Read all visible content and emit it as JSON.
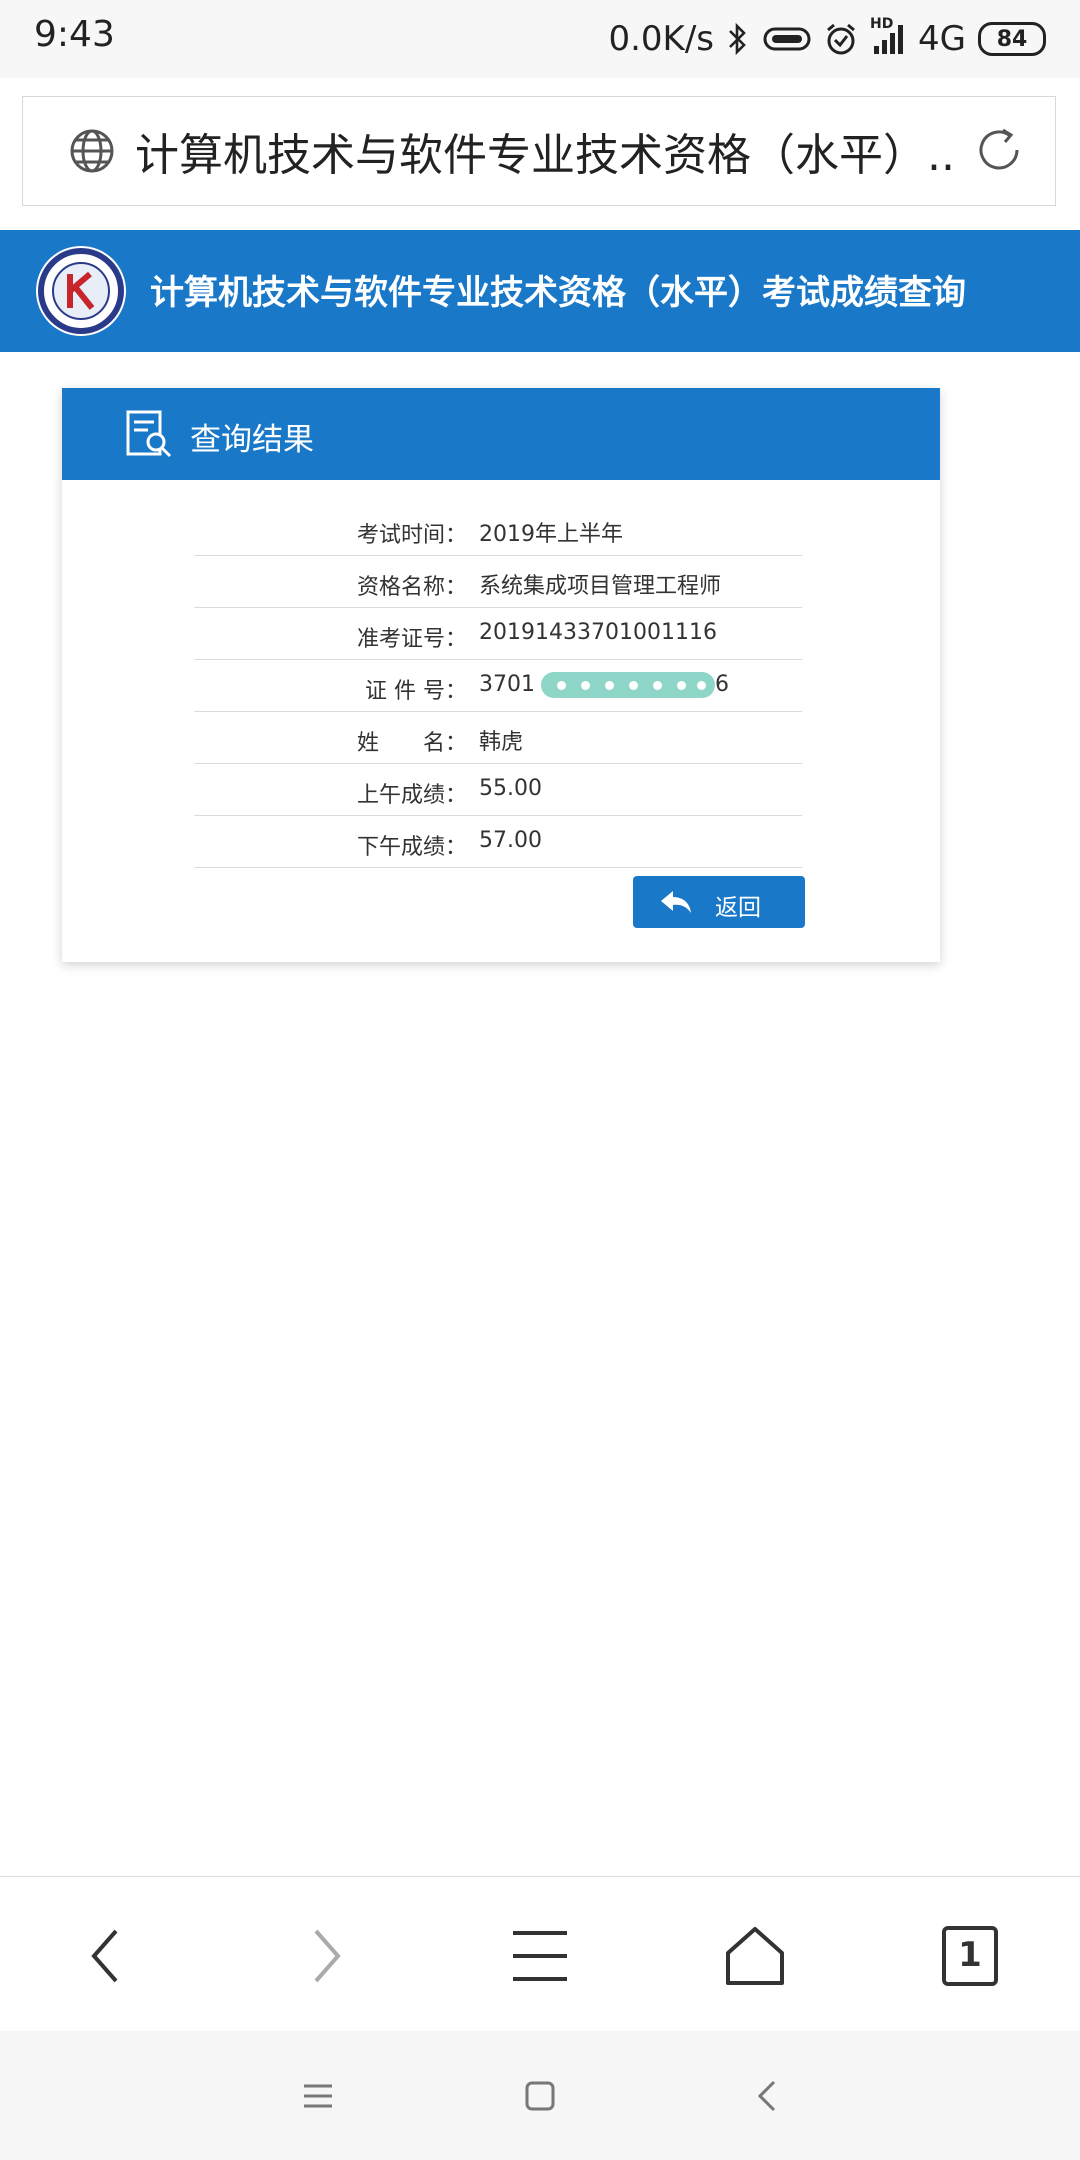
{
  "status_bar": {
    "time": "9:43",
    "net_speed": "0.0K/s",
    "network_type": "4G",
    "hd_label": "HD",
    "battery": "84"
  },
  "browser": {
    "url_title": "计算机技术与软件专业技术资格（水平）...",
    "tab_count": "1"
  },
  "site": {
    "banner_title": "计算机技术与软件专业技术资格（水平）考试成绩查询",
    "accent_color": "#1a78c8"
  },
  "result_card": {
    "title": "查询结果",
    "rows": [
      {
        "label": "考试时间：",
        "value": "2019年上半年"
      },
      {
        "label": "资格名称：",
        "value": "系统集成项目管理工程师"
      },
      {
        "label": "准考证号：",
        "value": "20191433701001116"
      },
      {
        "label": "证 件 号：",
        "value": "3701",
        "value_suffix": "6"
      },
      {
        "label": "姓　　名：",
        "value": "韩虎"
      },
      {
        "label": "上午成绩：",
        "value": "55.00"
      },
      {
        "label": "下午成绩：",
        "value": "57.00"
      }
    ],
    "back_button_label": "返回"
  },
  "icons": {
    "url_bar": [
      "globe-icon",
      "reload-icon"
    ],
    "toolbar": [
      "back-arrow-icon",
      "forward-arrow-icon",
      "menu-icon",
      "home-icon",
      "tabs-icon"
    ],
    "system_nav": [
      "recent-apps-icon",
      "home-square-icon",
      "back-chevron-icon"
    ]
  }
}
